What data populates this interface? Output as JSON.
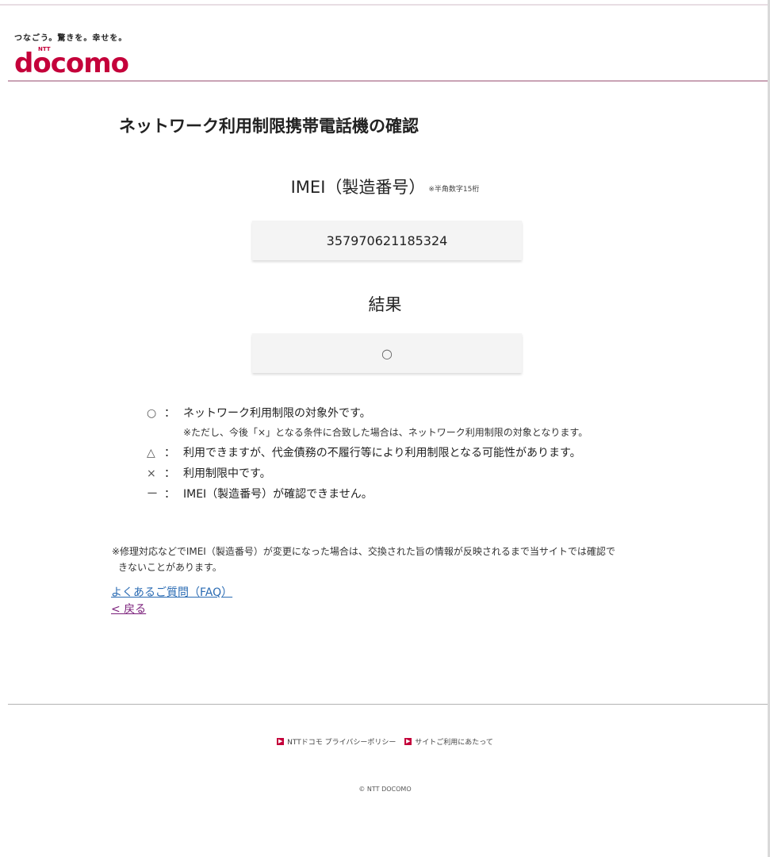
{
  "header": {
    "tagline": "つなごう。驚きを。幸せを。",
    "logo_ntt": "NTT",
    "logo_text": "docomo"
  },
  "main": {
    "title": "ネットワーク利用制限携帯電話機の確認",
    "imei_label": "IMEI（製造番号）",
    "imei_note": "※半角数字15桁",
    "imei_value": "357970621185324",
    "result_label": "結果",
    "result_value": "○"
  },
  "legend": [
    {
      "symbol": "○",
      "colon": "：",
      "text": "ネットワーク利用制限の対象外です。"
    },
    {
      "note": "※ただし、今後「×」となる条件に合致した場合は、ネットワーク利用制限の対象となります。"
    },
    {
      "symbol": "△",
      "colon": "：",
      "text": "利用できますが、代金債務の不履行等により利用制限となる可能性があります。"
    },
    {
      "symbol": "×",
      "colon": "：",
      "text": "利用制限中です。"
    },
    {
      "symbol": "ー",
      "colon": "：",
      "text": "IMEI（製造番号）が確認できません。"
    }
  ],
  "footnote": {
    "line1": "※修理対応などでIMEI（製造番号）が変更になった場合は、交換された旨の情報が反映されるまで当サイトでは確認で",
    "line2": "きないことがあります。"
  },
  "links": {
    "faq": "よくあるご質問（FAQ）",
    "back": "< 戻る"
  },
  "footer": {
    "privacy": "NTTドコモ プライバシーポリシー",
    "terms": "サイトご利用にあたって",
    "copyright": "© NTT DOCOMO"
  },
  "colors": {
    "brand": "#c4003a",
    "link": "#2a6bb3",
    "visited_link": "#7a1f7a"
  }
}
